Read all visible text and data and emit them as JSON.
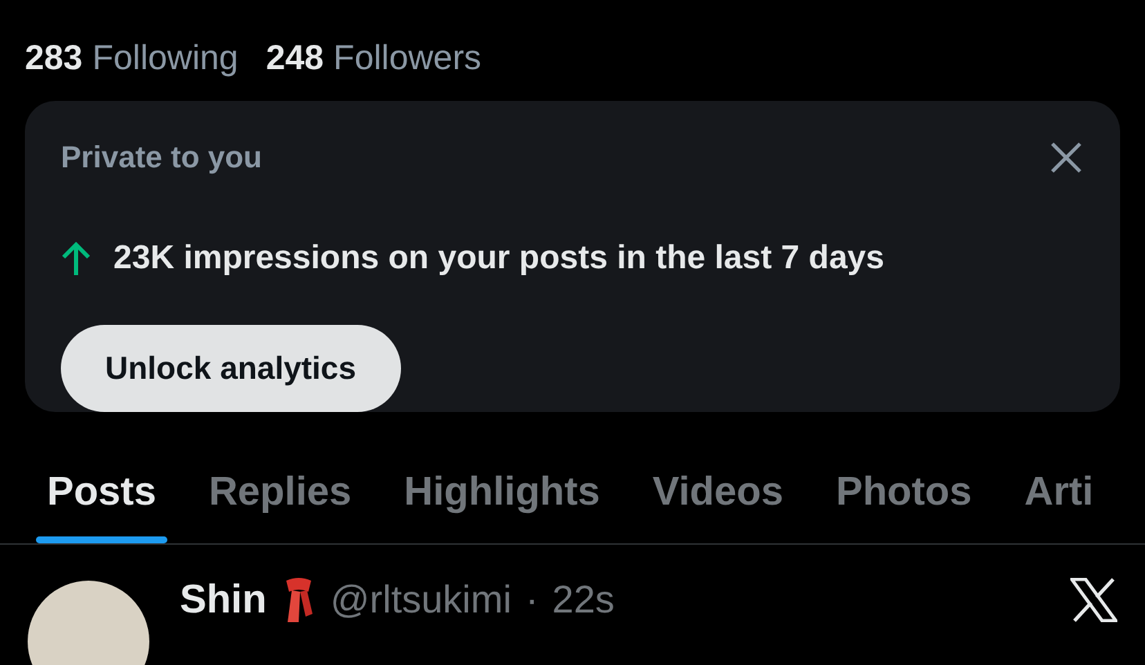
{
  "stats": [
    {
      "count": "283",
      "label": "Following"
    },
    {
      "count": "248",
      "label": "Followers"
    }
  ],
  "analytics_card": {
    "title": "Private to you",
    "message": "23K impressions on your posts in the last 7 days",
    "button": "Unlock analytics"
  },
  "tabs": [
    {
      "label": "Posts",
      "selected": true
    },
    {
      "label": "Replies",
      "selected": false
    },
    {
      "label": "Highlights",
      "selected": false
    },
    {
      "label": "Videos",
      "selected": false
    },
    {
      "label": "Photos",
      "selected": false
    },
    {
      "label": "Arti",
      "selected": false
    }
  ],
  "post": {
    "name": "Shin",
    "handle": "@rltsukimi",
    "separator": "·",
    "time": "22s"
  }
}
